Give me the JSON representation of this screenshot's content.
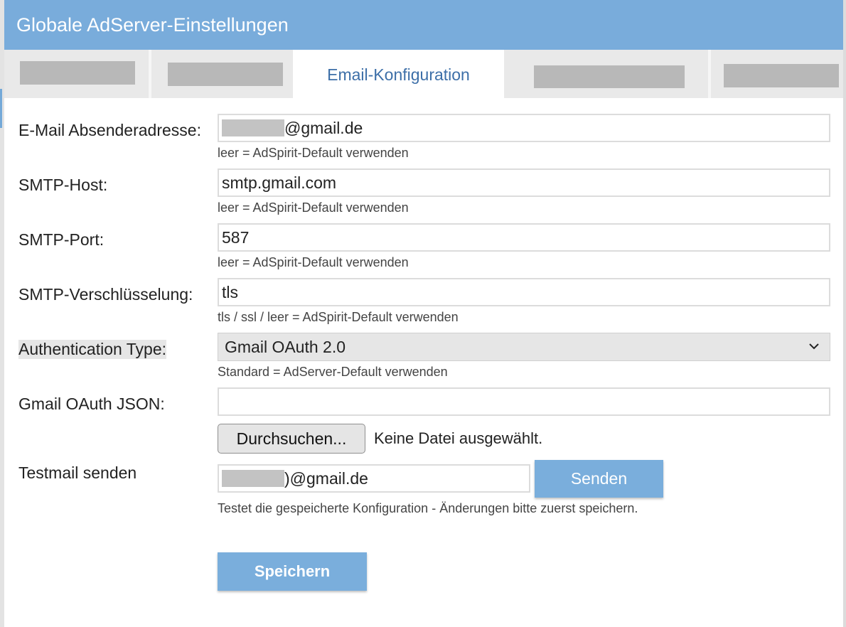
{
  "window": {
    "title": "Globale AdServer-Einstellungen"
  },
  "tabs": [
    {
      "label": "",
      "redacted": true
    },
    {
      "label": "",
      "redacted": true
    },
    {
      "label": "Email-Konfiguration",
      "active": true
    },
    {
      "label": "",
      "redacted": true
    },
    {
      "label": "",
      "redacted": true
    }
  ],
  "form": {
    "sender": {
      "label": "E-Mail Absenderadresse:",
      "value_visible": "@gmail.de",
      "hint": "leer = AdSpirit-Default verwenden"
    },
    "smtp_host": {
      "label": "SMTP-Host:",
      "value": "smtp.gmail.com",
      "hint": "leer = AdSpirit-Default verwenden"
    },
    "smtp_port": {
      "label": "SMTP-Port:",
      "value": "587",
      "hint": "leer = AdSpirit-Default verwenden"
    },
    "smtp_encryption": {
      "label": "SMTP-Verschlüsselung:",
      "value": "tls",
      "hint": "tls / ssl / leer = AdSpirit-Default verwenden"
    },
    "auth_type": {
      "label": "Authentication Type:",
      "selected": "Gmail OAuth 2.0",
      "hint": "Standard = AdServer-Default verwenden"
    },
    "oauth_json": {
      "label": "Gmail OAuth JSON:",
      "value": "",
      "browse_label": "Durchsuchen...",
      "file_status": "Keine Datei ausgewählt."
    },
    "testmail": {
      "label": "Testmail senden",
      "value_visible": ")@gmail.de",
      "send_label": "Senden",
      "hint": "Testet die gespeicherte Konfiguration - Änderungen bitte zuerst speichern."
    },
    "save_label": "Speichern"
  },
  "colors": {
    "header": "#79acdb",
    "active_tab_text": "#3d6fa8",
    "button": "#7aaedc"
  },
  "icons": {
    "select_arrow": "chevron-down-icon"
  }
}
